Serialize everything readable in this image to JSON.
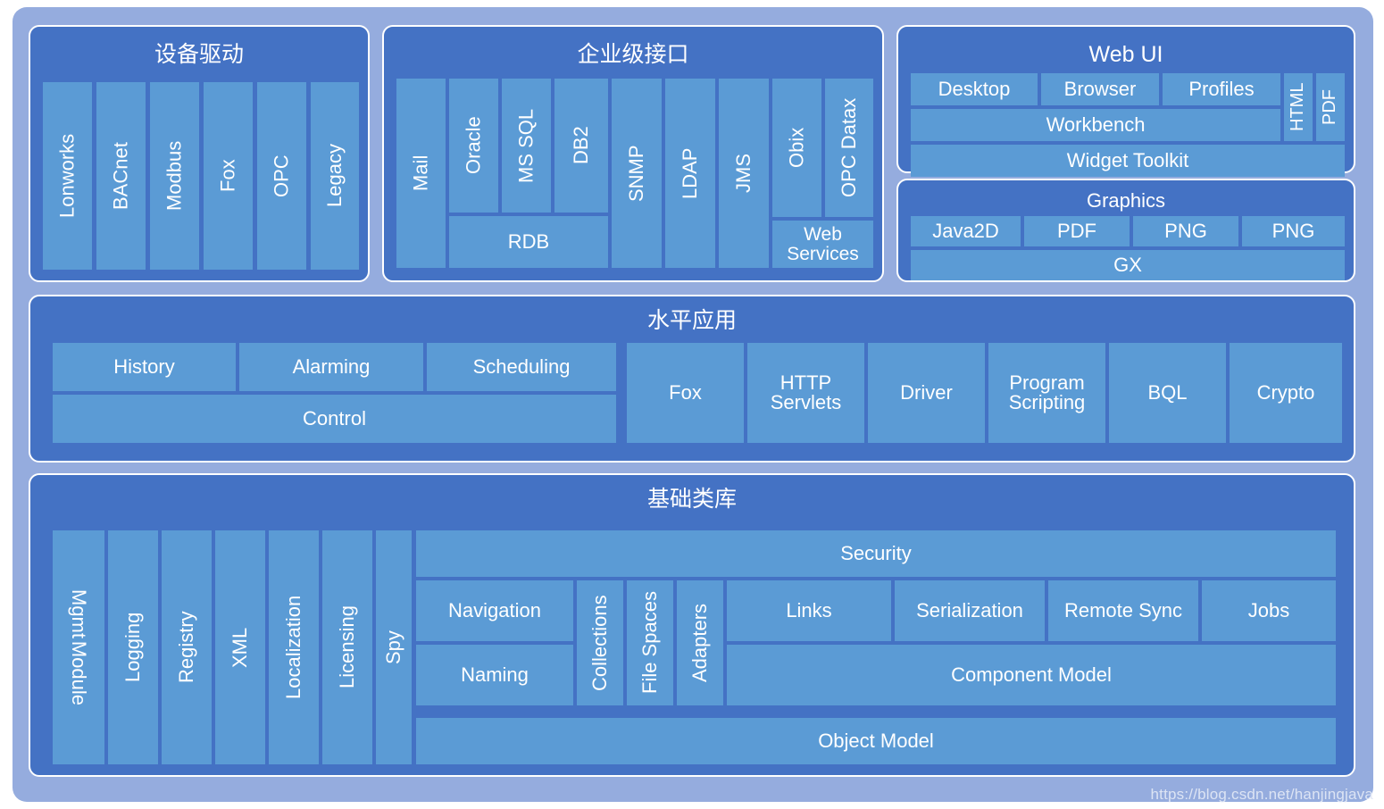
{
  "diagram": {
    "watermark": "https://blog.csdn.net/hanjingjava",
    "colors": {
      "page_background": "#ffffff",
      "outer_frame": "#95acde",
      "panel": "#4472c4",
      "tile": "#5b9bd5",
      "text": "#ffffff"
    }
  },
  "device_drivers": {
    "title": "设备驱动",
    "items": [
      "Lonworks",
      "BACnet",
      "Modbus",
      "Fox",
      "OPC",
      "Legacy"
    ]
  },
  "enterprise_interface": {
    "title": "企业级接口",
    "columns": [
      "Mail",
      "Oracle",
      "MS SQL",
      "DB2",
      "SNMP",
      "LDAP",
      "JMS",
      "Obix",
      "OPC Datax"
    ],
    "spans": [
      {
        "label": "RDB",
        "covers": [
          "Oracle",
          "MS SQL",
          "DB2"
        ]
      },
      {
        "label": "Web Services",
        "covers": [
          "Obix",
          "OPC Datax"
        ]
      }
    ]
  },
  "web_ui": {
    "title": "Web UI",
    "row1": [
      "Desktop",
      "Browser",
      "Profiles"
    ],
    "side": [
      "HTML",
      "PDF"
    ],
    "row2": "Workbench",
    "row3": "Widget Toolkit"
  },
  "graphics": {
    "title": "Graphics",
    "row1": [
      "Java2D",
      "PDF",
      "PNG",
      "PNG"
    ],
    "row2": "GX"
  },
  "horizontal_apps": {
    "title": "水平应用",
    "left_row1": [
      "History",
      "Alarming",
      "Scheduling"
    ],
    "left_row2": "Control",
    "right": [
      "Fox",
      "HTTP Servlets",
      "Driver",
      "Program Scripting",
      "BQL",
      "Crypto"
    ]
  },
  "base_class_library": {
    "title": "基础类库",
    "vertical_left": [
      "Module Mgmt",
      "Logging",
      "Registry",
      "XML",
      "Localization",
      "Licensing",
      "Spy"
    ],
    "module_mgmt_lines": [
      "Module",
      "Mgmt"
    ],
    "security": "Security",
    "navigation": "Navigation",
    "naming": "Naming",
    "vertical_mid": [
      "Collections",
      "File Spaces",
      "Adapters"
    ],
    "links": "Links",
    "serialization": "Serialization",
    "remote_sync": "Remote Sync",
    "jobs": "Jobs",
    "component_model": "Component Model",
    "object_model": "Object Model"
  }
}
